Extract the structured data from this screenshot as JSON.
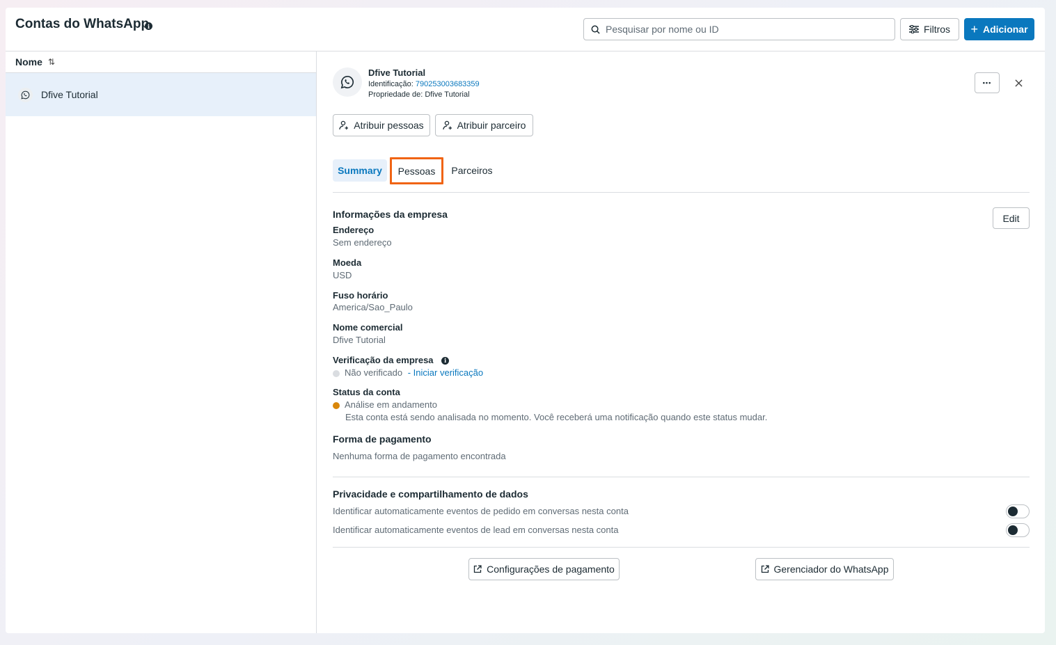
{
  "header": {
    "title": "Contas do WhatsApp",
    "search_placeholder": "Pesquisar por nome ou ID",
    "filters_label": "Filtros",
    "add_label": "Adicionar"
  },
  "list": {
    "column_header": "Nome",
    "items": [
      {
        "label": "Dfive Tutorial"
      }
    ]
  },
  "account": {
    "name": "Dfive Tutorial",
    "id_label": "Identificação:",
    "id_value": "790253003683359",
    "owner_label": "Propriedade de:",
    "owner_value": "Dfive Tutorial",
    "more_label": "•••",
    "assign_people_label": "Atribuir pessoas",
    "assign_partner_label": "Atribuir parceiro"
  },
  "tabs": [
    {
      "label": "Summary",
      "active": true
    },
    {
      "label": "Pessoas",
      "highlighted": true
    },
    {
      "label": "Parceiros"
    }
  ],
  "company_info": {
    "title": "Informações da empresa",
    "edit_label": "Edit",
    "address_label": "Endereço",
    "address_value": "Sem endereço",
    "currency_label": "Moeda",
    "currency_value": "USD",
    "timezone_label": "Fuso horário",
    "timezone_value": "America/Sao_Paulo",
    "trade_name_label": "Nome comercial",
    "trade_name_value": "Dfive Tutorial",
    "verification_label": "Verificação da empresa",
    "verification_status": "Não verificado",
    "verification_link": "- Iniciar verificação",
    "account_status_label": "Status da conta",
    "account_status_value": "Análise em andamento",
    "account_status_note": "Esta conta está sendo analisada no momento. Você receberá uma notificação quando este status mudar.",
    "payment_label": "Forma de pagamento",
    "payment_value": "Nenhuma forma de pagamento encontrada"
  },
  "privacy": {
    "title": "Privacidade e compartilhamento de dados",
    "toggles": [
      {
        "label": "Identificar automaticamente eventos de pedido em conversas nesta conta",
        "on": false
      },
      {
        "label": "Identificar automaticamente eventos de lead em conversas nesta conta",
        "on": false
      }
    ]
  },
  "footer": {
    "payment_config_label": "Configurações de pagamento",
    "wa_manager_label": "Gerenciador do WhatsApp"
  },
  "colors": {
    "accent": "#0a78be",
    "highlight": "#f06414",
    "status_pending": "#d9870b"
  }
}
